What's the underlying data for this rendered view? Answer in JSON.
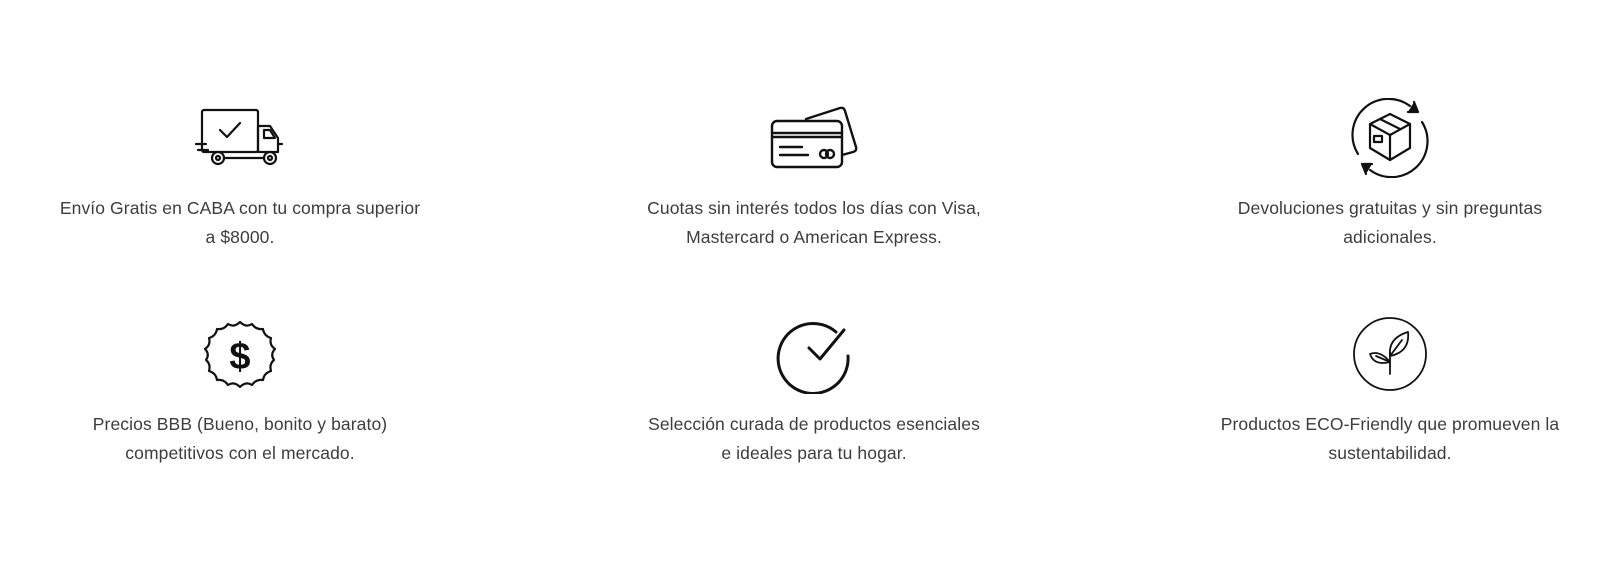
{
  "features": [
    {
      "icon": "delivery-truck-icon",
      "text": "Envío Gratis en CABA con tu compra superior a $8000."
    },
    {
      "icon": "credit-card-icon",
      "text": "Cuotas sin interés todos los días con Visa, Mastercard o American Express."
    },
    {
      "icon": "return-box-icon",
      "text": "Devoluciones gratuitas y sin preguntas adicionales."
    },
    {
      "icon": "dollar-badge-icon",
      "text": "Precios BBB (Bueno, bonito y barato) competitivos con el mercado."
    },
    {
      "icon": "check-circle-icon",
      "text": "Selección curada de productos esenciales e ideales para tu hogar."
    },
    {
      "icon": "eco-leaf-icon",
      "text": "Productos ECO-Friendly que promueven la sustentabilidad."
    }
  ]
}
